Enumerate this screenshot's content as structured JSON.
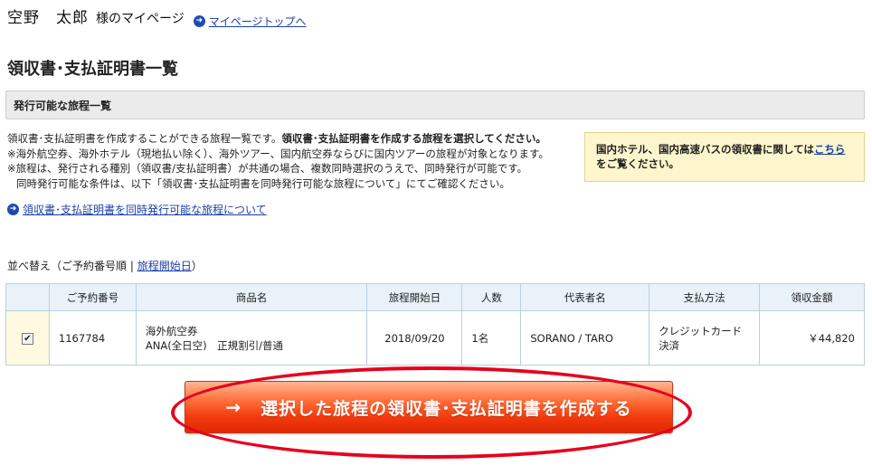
{
  "header": {
    "user_name": "空野　太郎",
    "user_suffix": "様のマイページ",
    "top_link_label": "マイページトップへ"
  },
  "page_title": "領収書･支払証明書一覧",
  "section_title": "発行可能な旅程一覧",
  "description": {
    "line1_normal": "領収書･支払証明書を作成することができる旅程一覧です。",
    "line1_bold": "領収書･支払証明書を作成する旅程を選択してください。",
    "line2": "※海外航空券、海外ホテル（現地払い除く）、海外ツアー、国内航空券ならびに国内ツアーの旅程が対象となります。",
    "line3": "※旅程は、発行される種別（領収書/支払証明書）が共通の場合、複数同時選択のうえで、同時発行が可能です。",
    "line4": "同時発行可能な条件は、以下「領収書･支払証明書を同時発行可能な旅程について」にてご確認ください。"
  },
  "notice": {
    "text_before": "国内ホテル、国内高速バスの領収書に関しては",
    "link": "こちら",
    "text_after": "をご覧ください。"
  },
  "about_link": "領収書･支払証明書を同時発行可能な旅程について",
  "sort": {
    "prefix": "並べ替え（",
    "option1": "ご予約番号順",
    "separator": " | ",
    "option2": "旅程開始日",
    "suffix": "）"
  },
  "table": {
    "headers": [
      "",
      "ご予約番号",
      "商品名",
      "旅程開始日",
      "人数",
      "代表者名",
      "支払方法",
      "領収金額"
    ],
    "rows": [
      {
        "checked": true,
        "reservation_no": "1167784",
        "product_line1": "海外航空券",
        "product_line2": "ANA(全日空)　正規割引/普通",
        "start_date": "2018/09/20",
        "people": "1名",
        "representative": "SORANO / TARO",
        "payment": "クレジットカード決済",
        "amount": "￥44,820"
      }
    ]
  },
  "create_button": {
    "arrow": "→",
    "label": "選択した旅程の領収書･支払証明書を作成する"
  },
  "colors": {
    "link": "#1a3fa8",
    "button": "#f23a0c",
    "highlight_ellipse": "#e6001c",
    "notice_bg": "#fdf6cd",
    "table_header_bg": "#e9f2f9"
  }
}
